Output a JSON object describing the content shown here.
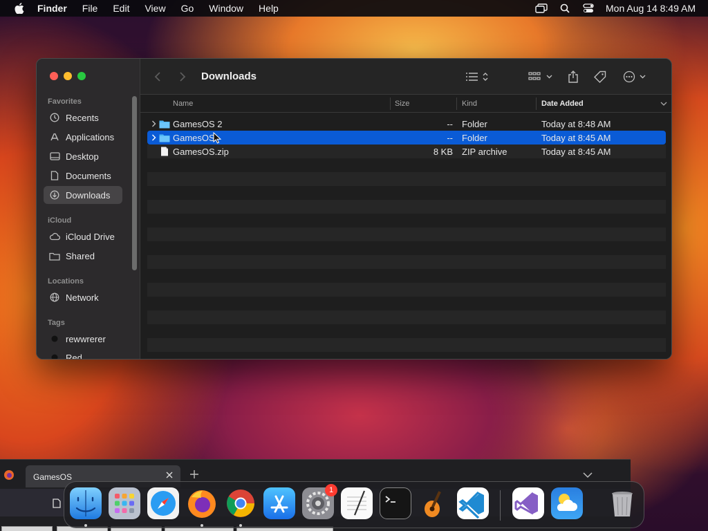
{
  "menubar": {
    "app_name": "Finder",
    "items": [
      "File",
      "Edit",
      "View",
      "Go",
      "Window",
      "Help"
    ],
    "clock": "Mon Aug 14  8:49 AM"
  },
  "finder": {
    "title": "Downloads",
    "sidebar": {
      "sections": {
        "favorites": "Favorites",
        "icloud": "iCloud",
        "locations": "Locations",
        "tags": "Tags"
      },
      "favorites": [
        "Recents",
        "Applications",
        "Desktop",
        "Documents",
        "Downloads"
      ],
      "icloud": [
        "iCloud Drive",
        "Shared"
      ],
      "locations": [
        "Network"
      ],
      "tags": [
        "rewwrerer",
        "Red"
      ]
    },
    "columns": {
      "name": "Name",
      "size": "Size",
      "kind": "Kind",
      "date": "Date Added"
    },
    "files": [
      {
        "name": "GamesOS 2",
        "size": "--",
        "kind": "Folder",
        "date": "Today at 8:48 AM"
      },
      {
        "name": "GamesOS",
        "size": "--",
        "kind": "Folder",
        "date": "Today at 8:45 AM"
      },
      {
        "name": "GamesOS.zip",
        "size": "8 KB",
        "kind": "ZIP archive",
        "date": "Today at 8:45 AM"
      }
    ],
    "colors": {
      "selection": "#0a5bd6",
      "folder": "#4fb6f5"
    }
  },
  "browser": {
    "tab_title": "GamesOS"
  },
  "dock": {
    "settings_badge": "1"
  }
}
